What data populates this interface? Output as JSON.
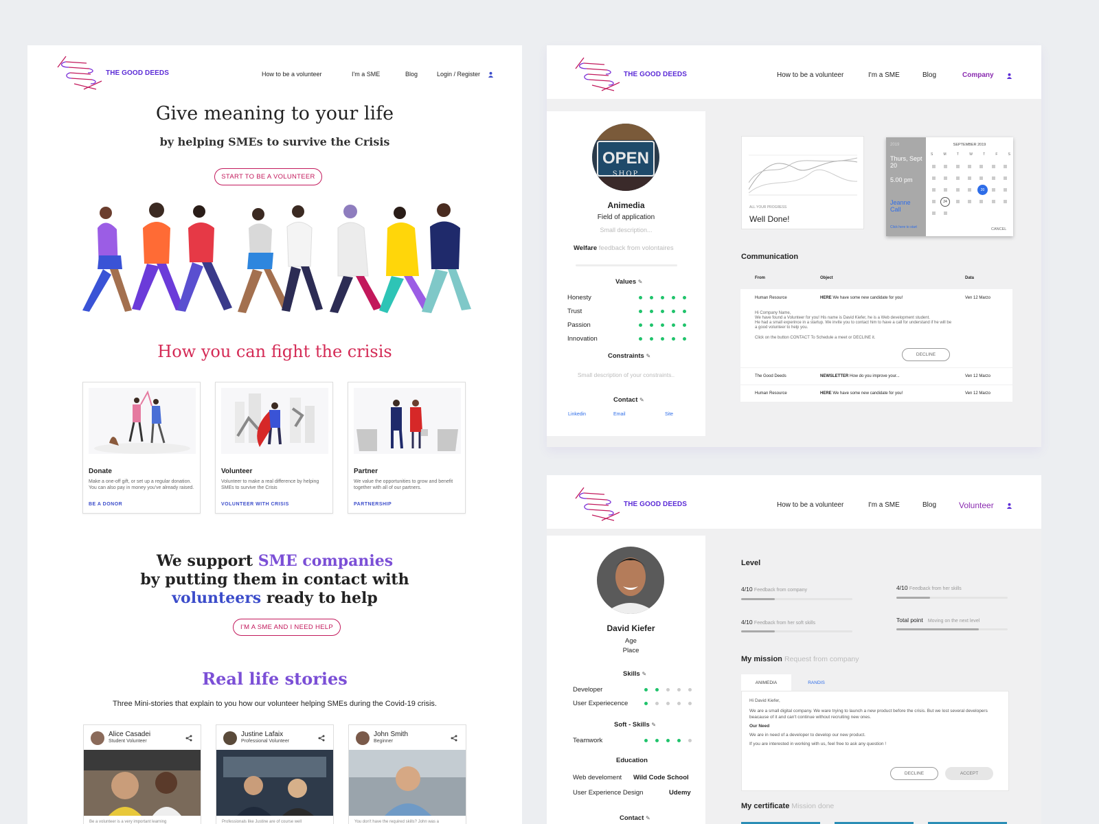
{
  "brand": {
    "name": "THE GOOD DEEDS"
  },
  "landing": {
    "nav": [
      "How to be a volunteer",
      "I'm a SME",
      "Blog",
      "Login / Register"
    ],
    "hero_title": "Give meaning to your life",
    "hero_subtitle": "by helping SMEs to survive the Crisis",
    "hero_cta": "START TO BE A VOLUNTEER",
    "fight_title": "How you can fight the crisis",
    "cards": [
      {
        "title": "Donate",
        "desc": "Make a one-off gift, or set up a regular donation. You can also pay in money you've already raised.",
        "link": "BE A DONOR"
      },
      {
        "title": "Volunteer",
        "desc": "Volunteer to make a real difference by helping SMEs to survive the Crisis",
        "link": "VOLUNTEER WITH CRISIS"
      },
      {
        "title": "Partner",
        "desc": "We value the opportunities to grow and benefit together with all of our partners.",
        "link": "PARTNERSHIP"
      }
    ],
    "support_1a": "We support ",
    "support_1b": "SME companies",
    "support_2": "by putting them in contact with",
    "support_3a": "volunteers",
    "support_3b": " ready to help",
    "sme_cta": "I'M A SME AND I NEED HELP",
    "stories_title": "Real life stories",
    "stories_subtitle": "Three Mini-stories that explain to you how our volunteer  helping SMEs during the Covid-19 crisis.",
    "stories": [
      {
        "name": "Alice Casadei",
        "role": "Student Volunteer",
        "text": "Be a volunteer is a very important learning"
      },
      {
        "name": "Justine Lafaix",
        "role": "Professional Volunteer",
        "text": "Professionals like Justine are of course well"
      },
      {
        "name": "John Smith",
        "role": "Beginner",
        "text": "You don't have the required skills? John was a"
      }
    ]
  },
  "company": {
    "nav": [
      "How to be a volunteer",
      "I'm a SME",
      "Blog",
      "Company"
    ],
    "profile": {
      "name": "Animedia",
      "field": "Field of application",
      "desc": "Small description...",
      "welfare_label": "Welfare",
      "welfare_hint": "feedback from volontaires",
      "avatar_text_1": "OPEN",
      "avatar_text_2": "SHOP"
    },
    "values_title": "Values",
    "values": [
      {
        "label": "Honesty",
        "score": 5
      },
      {
        "label": "Trust",
        "score": 5
      },
      {
        "label": "Passion",
        "score": 5
      },
      {
        "label": "Innovation",
        "score": 5
      }
    ],
    "constraints_title": "Constraints",
    "constraints_hint": "Small description of your constraints..",
    "contact_title": "Contact",
    "contact_links": [
      "Linkedin",
      "Email",
      "Site"
    ],
    "progress": {
      "caption": "ALL YOUR PROGRESS",
      "message": "Well Done!"
    },
    "calendar": {
      "year": "2019",
      "day": "Thurs, Sept 20",
      "time": "5.00 pm",
      "person": "Jeanne Call",
      "hint": "Click here to start",
      "month": "SEPTEMBER 2019",
      "weekdays": [
        "S",
        "M",
        "T",
        "W",
        "T",
        "F",
        "S"
      ],
      "selected_day": "20",
      "circled_day": "24",
      "cancel": "CANCEL"
    },
    "communication_title": "Communication",
    "table_headers": [
      "From",
      "Object",
      "Data"
    ],
    "messages": [
      {
        "from": "Human Resource",
        "tag": "HERE",
        "object": "We have some new candidate for you!",
        "date": "Ven 12 Marzo"
      },
      {
        "from": "The Good Deeds",
        "tag": "NEWSLETTER",
        "object": "How do you improve your...",
        "date": "Ven 12 Marzo"
      },
      {
        "from": "Human Resource",
        "tag": "HERE",
        "object": "We have some new candidate for you!",
        "date": "Ven 12 Marzo"
      }
    ],
    "message_body": {
      "greeting": "Hi Company Name,",
      "line1": "We have found a Volunteer for you! His name is David Kiefer, he is a Web development student.",
      "line2": "He had a small experince in a startup. We invite you to contact him to have a call for understand if he will be",
      "line3": "a good volunteer to help you.",
      "line4": "Click on the button CONTACT To Schedule a meet or DECLINE it.",
      "decline": "DECLINE"
    }
  },
  "volunteer": {
    "nav": [
      "How to be a volunteer",
      "I'm a SME",
      "Blog",
      "Volunteer"
    ],
    "profile": {
      "name": "David Kiefer",
      "age": "Age",
      "place": "Place"
    },
    "skills_title": "Skills",
    "skills": [
      {
        "label": "Developer",
        "score": 2
      },
      {
        "label": "User Experiecence",
        "score": 1
      }
    ],
    "soft_title": "Soft - Skills",
    "soft": [
      {
        "label": "Teamwork",
        "score": 4
      }
    ],
    "education_title": "Education",
    "education": [
      {
        "label": "Web develoment",
        "school": "Wild Code School"
      },
      {
        "label": "User Experience Design",
        "school": "Udemy"
      }
    ],
    "contact_title": "Contact",
    "level_title": "Level",
    "levels": [
      {
        "value": "4/10",
        "label": "Feedback from company",
        "fill": 0.3
      },
      {
        "value": "4/10",
        "label": "Feedback from her skills",
        "fill": 0.3
      },
      {
        "value": "4/10",
        "label": "Feedback from her soft skills",
        "fill": 0.3
      },
      {
        "value": "Total point",
        "label": "Moving on the next level",
        "fill": 0.74
      }
    ],
    "mission_title": "My mission",
    "mission_hint": "Request from company",
    "mission_tabs": [
      "ANIMEDIA",
      "RANDIS"
    ],
    "mission_body": {
      "greeting": "Hi David Kiefer,",
      "p1": "We are a small digital company. We ware trying to launch a new product before the crisis. But we lost several developers beacause of it and can't continue without recruiting new ones.",
      "need_title": "Our Need",
      "p2": "We are in need of a developer to develop our new product.",
      "p3": "If you are interested in working with us, feel free to ask any question !",
      "decline": "DECLINE",
      "accept": "ACCEPT"
    },
    "certificate_title": "My certificate",
    "certificate_hint": "Mission done"
  },
  "colors": {
    "brand_purple": "#5b2bd6",
    "crimson": "#c2185b",
    "green": "#1fc36b",
    "blue": "#3b4cca",
    "violet": "#7b4fd6"
  }
}
